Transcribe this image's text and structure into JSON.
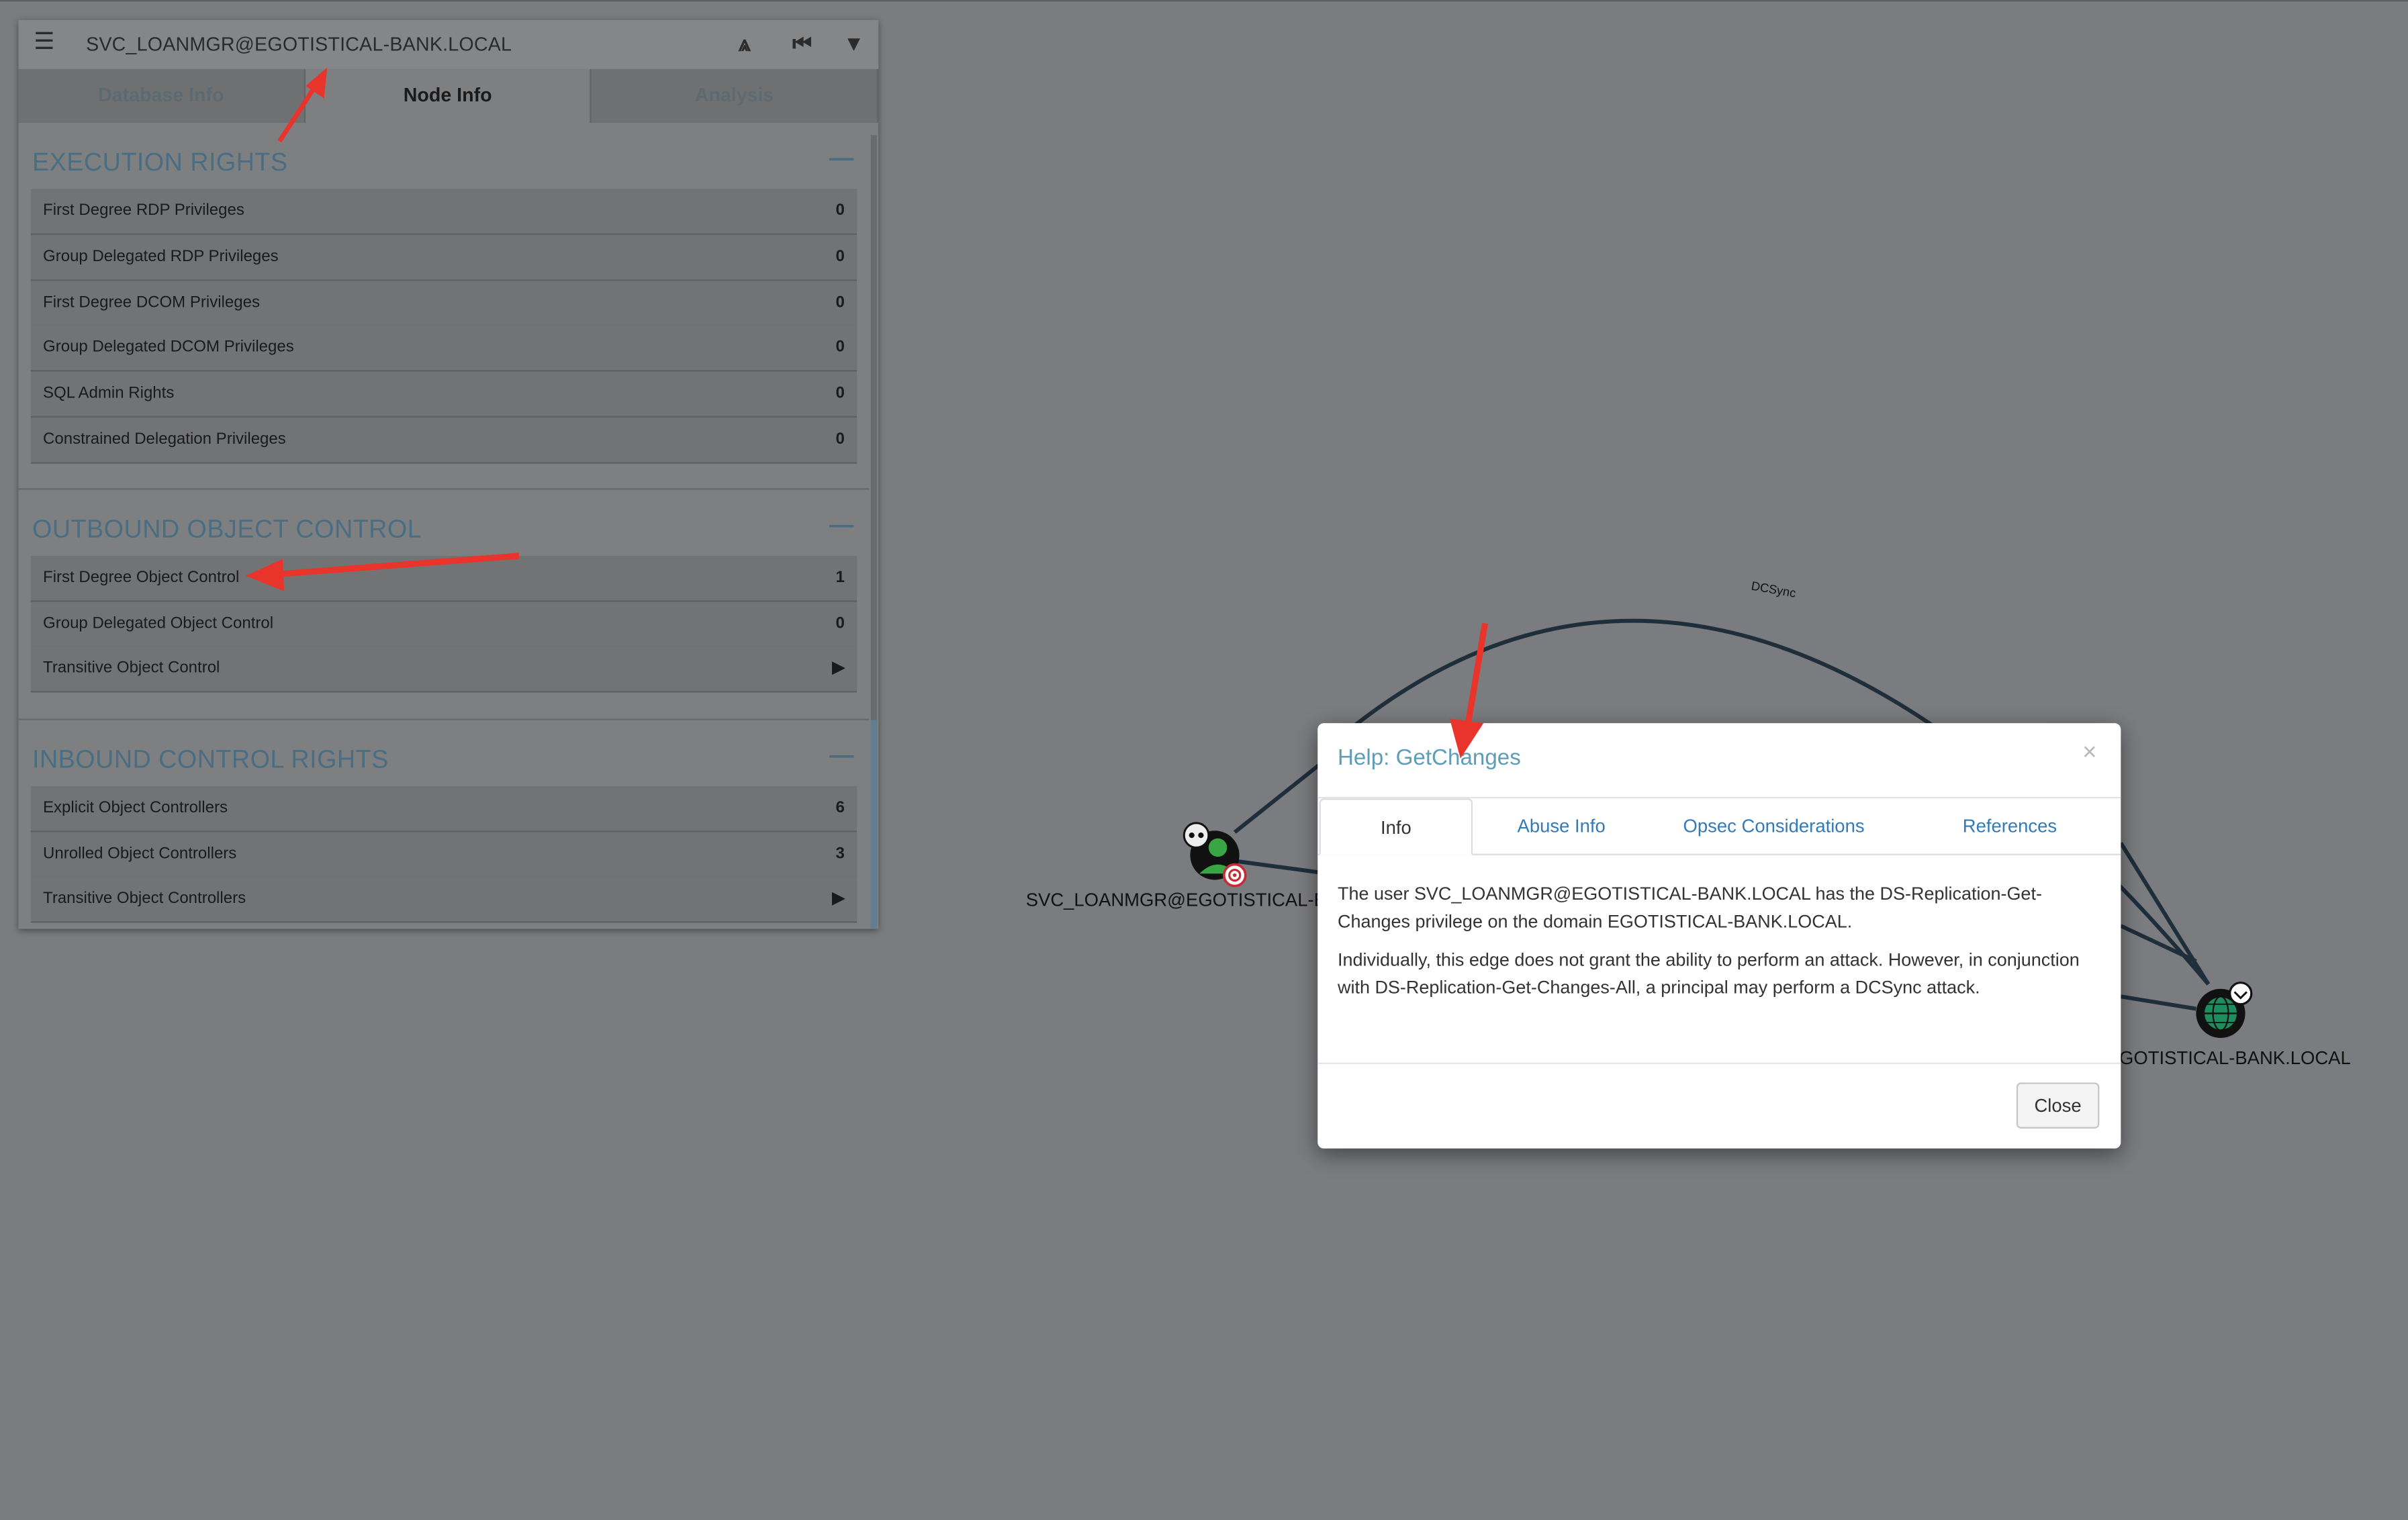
{
  "panel": {
    "node_name": "SVC_LOANMGR@EGOTISTICAL-BANK.LOCAL",
    "tabs": [
      "Database Info",
      "Node Info",
      "Analysis"
    ],
    "sections": [
      {
        "title": "EXECUTION RIGHTS",
        "collapse": "—",
        "rows": [
          {
            "label": "First Degree RDP Privileges",
            "value": "0"
          },
          {
            "label": "Group Delegated RDP Privileges",
            "value": "0"
          },
          {
            "label": "First Degree DCOM Privileges",
            "value": "0"
          },
          {
            "label": "Group Delegated DCOM Privileges",
            "value": "0"
          },
          {
            "label": "SQL Admin Rights",
            "value": "0"
          },
          {
            "label": "Constrained Delegation Privileges",
            "value": "0"
          }
        ]
      },
      {
        "title": "OUTBOUND OBJECT CONTROL",
        "collapse": "—",
        "rows": [
          {
            "label": "First Degree Object Control",
            "value": "1"
          },
          {
            "label": "Group Delegated Object Control",
            "value": "0"
          },
          {
            "label": "Transitive Object Control",
            "value": "▶"
          }
        ]
      },
      {
        "title": "INBOUND CONTROL RIGHTS",
        "collapse": "—",
        "rows": [
          {
            "label": "Explicit Object Controllers",
            "value": "6"
          },
          {
            "label": "Unrolled Object Controllers",
            "value": "3"
          },
          {
            "label": "Transitive Object Controllers",
            "value": "▶"
          }
        ]
      }
    ]
  },
  "graph": {
    "source_label": "SVC_LOANMGR@EGOTISTICAL-BAN",
    "target_label": "GOTISTICAL-BANK.LOCAL",
    "edge_label": "DCSync"
  },
  "modal": {
    "title": "Help: GetChanges",
    "close_x": "×",
    "tabs": [
      "Info",
      "Abuse Info",
      "Opsec Considerations",
      "References"
    ],
    "paragraphs": [
      "The user SVC_LOANMGR@EGOTISTICAL-BANK.LOCAL has the DS-Replication-Get-Changes privilege on the domain EGOTISTICAL-BANK.LOCAL.",
      "Individually, this edge does not grant the ability to perform an attack. However, in conjunction with DS-Replication-Get-Changes-All, a principal may perform a DCSync attack."
    ],
    "close_button": "Close"
  },
  "icons": [
    "menu-icon",
    "pathfinding-icon",
    "back-icon",
    "filter-icon",
    "user-node-icon",
    "domain-node-icon",
    "skull-icon",
    "target-icon"
  ],
  "colors": {
    "accent": "#5f9db7",
    "section_title": "#496e83",
    "link": "#337ab7",
    "annotation_arrow": "#e8342b"
  }
}
